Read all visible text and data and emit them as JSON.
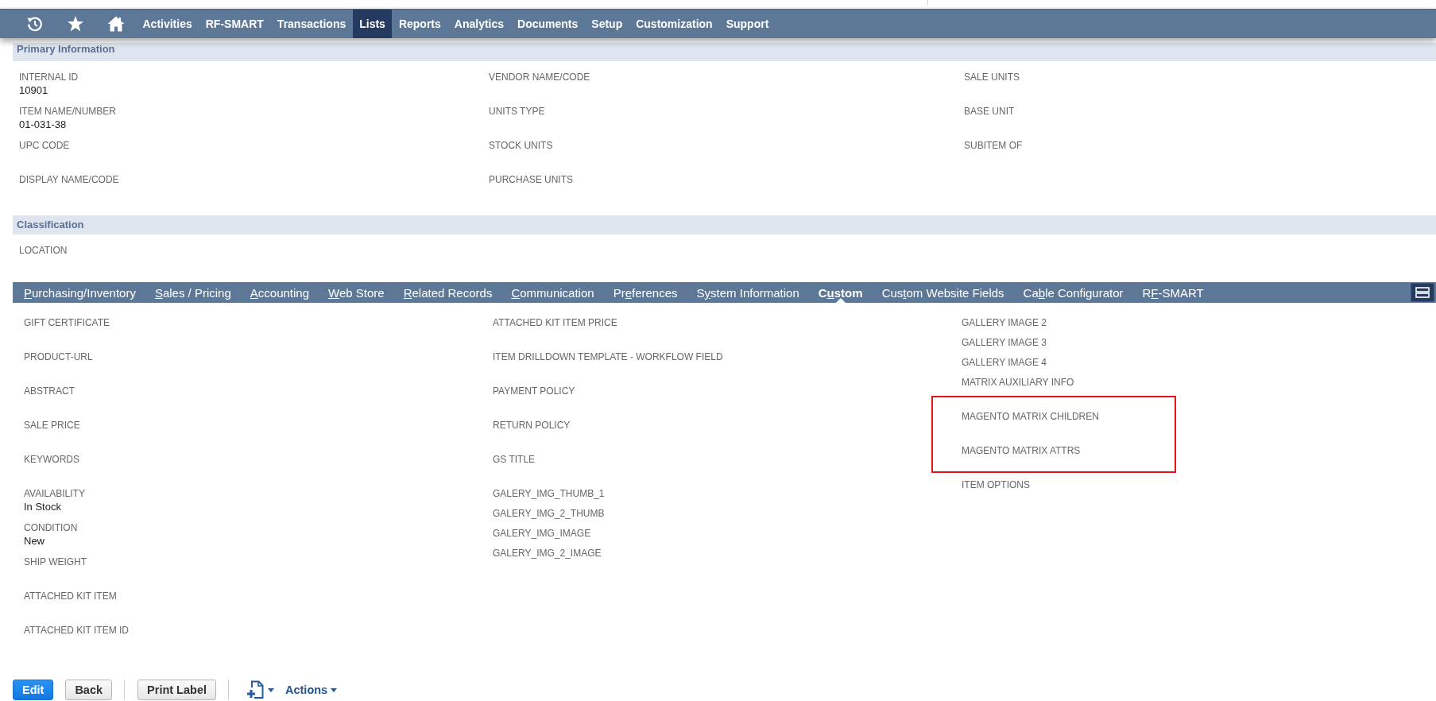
{
  "nav": {
    "items": [
      {
        "label": "Activities",
        "selected": false
      },
      {
        "label": "RF-SMART",
        "selected": false
      },
      {
        "label": "Transactions",
        "selected": false
      },
      {
        "label": "Lists",
        "selected": true
      },
      {
        "label": "Reports",
        "selected": false
      },
      {
        "label": "Analytics",
        "selected": false
      },
      {
        "label": "Documents",
        "selected": false
      },
      {
        "label": "Setup",
        "selected": false
      },
      {
        "label": "Customization",
        "selected": false
      },
      {
        "label": "Support",
        "selected": false
      }
    ]
  },
  "primary_information": {
    "title": "Primary Information",
    "columns": [
      {
        "fields": [
          {
            "label": "INTERNAL ID",
            "value": "10901"
          },
          {
            "label": "ITEM NAME/NUMBER",
            "value": "01-031-38"
          },
          {
            "label": "UPC CODE"
          },
          {
            "label": "DISPLAY NAME/CODE"
          }
        ]
      },
      {
        "fields": [
          {
            "label": "VENDOR NAME/CODE"
          },
          {
            "label": "UNITS TYPE"
          },
          {
            "label": "STOCK UNITS"
          },
          {
            "label": "PURCHASE UNITS"
          }
        ]
      },
      {
        "fields": [
          {
            "label": "SALE UNITS"
          },
          {
            "label": "BASE UNIT"
          },
          {
            "label": "SUBITEM OF"
          }
        ]
      }
    ]
  },
  "classification": {
    "title": "Classification",
    "columns": [
      {
        "fields": [
          {
            "label": "LOCATION"
          }
        ]
      }
    ]
  },
  "subtabs": [
    {
      "key": "P",
      "after": "urchasing/Inventory",
      "selected": false
    },
    {
      "key": "S",
      "after": "ales / Pricing",
      "selected": false
    },
    {
      "key": "A",
      "after": "ccounting",
      "selected": false
    },
    {
      "key": "W",
      "after": "eb Store",
      "selected": false
    },
    {
      "key": "R",
      "after": "elated Records",
      "selected": false
    },
    {
      "key": "C",
      "after": "ommunication",
      "selected": false
    },
    {
      "before": "Pr",
      "key": "e",
      "after": "ferences",
      "selected": false
    },
    {
      "before": "S",
      "key": "y",
      "after": "stem Information",
      "selected": false
    },
    {
      "before": "C",
      "key": "u",
      "after": "stom",
      "selected": true
    },
    {
      "before": "Cus",
      "key": "t",
      "after": "om Website Fields",
      "selected": false
    },
    {
      "before": "Ca",
      "key": "b",
      "after": "le Configurator",
      "selected": false
    },
    {
      "before": "R",
      "key": "F",
      "after": "-SMART",
      "selected": false
    }
  ],
  "custom": {
    "columns": [
      {
        "fields": [
          {
            "kind": "standard",
            "label": "GIFT CERTIFICATE",
            "highlighted": false
          },
          {
            "kind": "standard",
            "label": "PRODUCT-URL",
            "highlighted": false
          },
          {
            "kind": "standard",
            "label": "ABSTRACT",
            "highlighted": false
          },
          {
            "kind": "standard",
            "label": "SALE PRICE",
            "highlighted": false
          },
          {
            "kind": "standard",
            "label": "KEYWORDS",
            "highlighted": false
          },
          {
            "kind": "standard",
            "label": "AVAILABILITY",
            "value": "In Stock",
            "highlighted": false
          },
          {
            "kind": "standard",
            "label": "CONDITION",
            "value": "New",
            "highlighted": false
          },
          {
            "kind": "standard",
            "label": "SHIP WEIGHT",
            "highlighted": false
          },
          {
            "kind": "standard",
            "label": "ATTACHED KIT ITEM",
            "highlighted": false
          },
          {
            "kind": "standard",
            "label": "ATTACHED KIT ITEM ID",
            "highlighted": false
          }
        ]
      },
      {
        "fields": [
          {
            "kind": "standard",
            "label": "ATTACHED KIT ITEM PRICE",
            "highlighted": false
          },
          {
            "kind": "standard",
            "label": "ITEM DRILLDOWN TEMPLATE - WORKFLOW FIELD",
            "highlighted": false
          },
          {
            "kind": "standard",
            "label": "PAYMENT POLICY",
            "highlighted": false
          },
          {
            "kind": "standard",
            "label": "RETURN POLICY",
            "highlighted": false
          },
          {
            "kind": "standard",
            "label": "GS TITLE",
            "highlighted": false
          },
          {
            "kind": "compact",
            "label": "GALERY_IMG_THUMB_1",
            "highlighted": false
          },
          {
            "kind": "compact",
            "label": "GALERY_IMG_2_THUMB",
            "highlighted": false
          },
          {
            "kind": "compact",
            "label": "GALERY_IMG_IMAGE",
            "highlighted": false
          },
          {
            "kind": "compact",
            "label": "GALERY_IMG_2_IMAGE",
            "highlighted": false
          }
        ]
      },
      {
        "fields": [
          {
            "kind": "compact",
            "label": "GALLERY IMAGE 2",
            "highlighted": false
          },
          {
            "kind": "compact",
            "label": "GALLERY IMAGE 3",
            "highlighted": false
          },
          {
            "kind": "compact",
            "label": "GALLERY IMAGE 4",
            "highlighted": false
          },
          {
            "kind": "standard",
            "label": "MATRIX AUXILIARY INFO",
            "highlighted": false
          },
          {
            "kind": "standard",
            "label": "MAGENTO MATRIX CHILDREN",
            "highlighted": true
          },
          {
            "kind": "standard",
            "label": "MAGENTO MATRIX ATTRS",
            "highlighted": true
          },
          {
            "kind": "standard",
            "label": "ITEM OPTIONS",
            "highlighted": false
          }
        ]
      }
    ]
  },
  "toolbar": {
    "button_groups": [
      {
        "buttons": [
          {
            "kind": "primary",
            "label": "Edit"
          },
          {
            "kind": "secondary",
            "label": "Back"
          }
        ]
      },
      {
        "buttons": [
          {
            "kind": "secondary",
            "label": "Print Label"
          }
        ]
      }
    ],
    "menu": {
      "label": "Actions"
    }
  }
}
